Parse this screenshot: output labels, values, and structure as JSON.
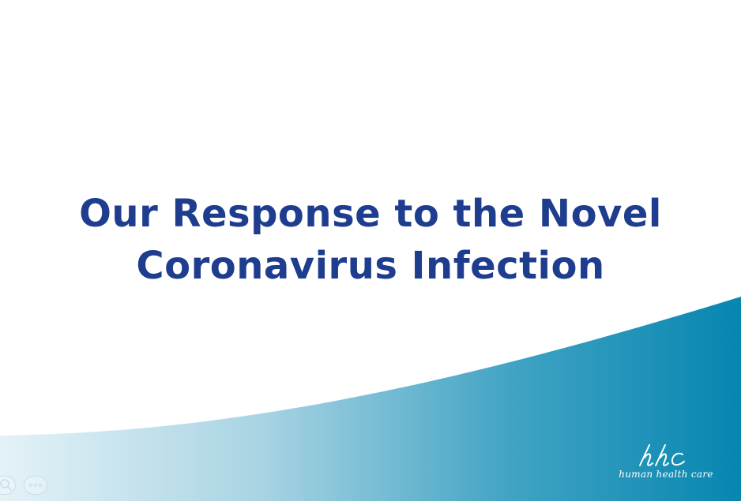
{
  "slide": {
    "title_line1": "Our Response to the Novel",
    "title_line2": "Coronavirus Infection"
  },
  "logo": {
    "tagline": "human health care"
  },
  "colors": {
    "title": "#1f3d8f",
    "swoosh_light": "#dff0f6",
    "swoosh_dark": "#0a88b1",
    "background": "#ffffff"
  },
  "icons": {
    "zoom_control": "magnifier-icon",
    "more_control": "ellipsis-icon"
  }
}
